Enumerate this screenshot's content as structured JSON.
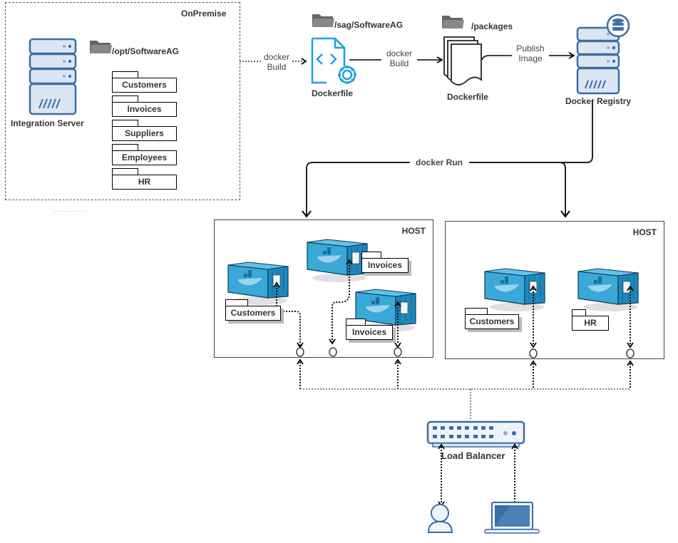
{
  "onpremise": {
    "label": "OnPremise",
    "server_label": "Integration Server",
    "folder_path": "/opt/SoftwareAG",
    "packages": [
      "Customers",
      "Invoices",
      "Suppliers",
      "Employees",
      "HR"
    ]
  },
  "build_stage": {
    "edge1_label": [
      "docker",
      "Build"
    ],
    "folder_path": "/sag/SoftwareAG",
    "dockerfile_label": "Dockerfile",
    "edge2_label": [
      "docker",
      "Build"
    ],
    "packages_folder": "/packages",
    "packages_doc_label": "Dockerfile",
    "edge3_label": [
      "Publish",
      "Image"
    ],
    "registry_label": "Docker Registry"
  },
  "run_edge_label": "docker Run",
  "hosts": [
    {
      "label": "HOST",
      "containers": [
        {
          "package": "Customers"
        },
        {
          "package": "Invoices"
        },
        {
          "package": "Invoices"
        }
      ]
    },
    {
      "label": "HOST",
      "containers": [
        {
          "package": "Customers"
        },
        {
          "package": "HR"
        }
      ]
    }
  ],
  "load_balancer_label": "Load Balancer",
  "clients": [
    "user",
    "laptop"
  ],
  "colors": {
    "server_fill": "#dce6f2",
    "server_stroke": "#3a6ea5",
    "dockerfile_blue": "#1ba1e2",
    "container_blue": "#3aa8d8",
    "folder_gray": "#666666"
  }
}
